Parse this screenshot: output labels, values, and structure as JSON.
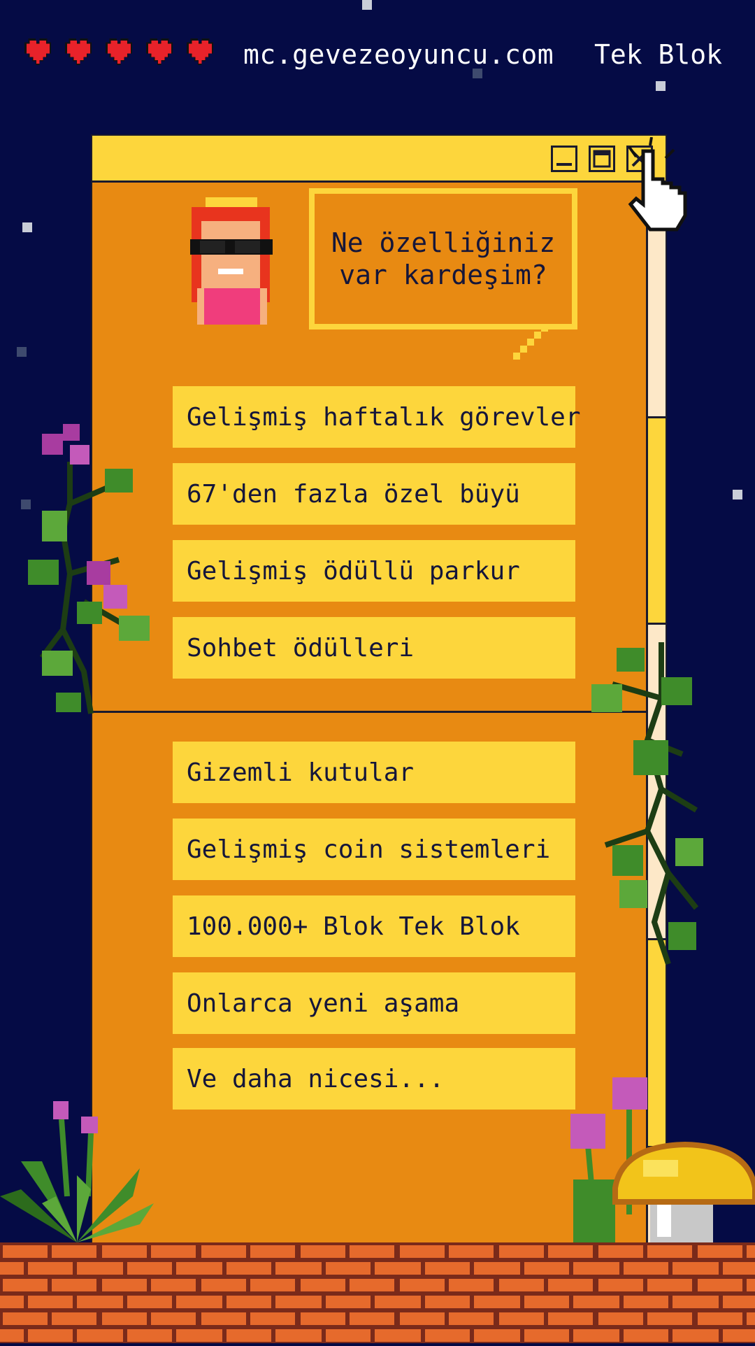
{
  "header": {
    "hearts": 5,
    "site_url": "mc.gevezeoyuncu.com",
    "brand": "Tek Blok"
  },
  "window": {
    "buttons": [
      "minimize-icon",
      "maximize-icon",
      "close-icon"
    ],
    "speech_bubble": "Ne özelliğiniz\nvar kardeşim?",
    "features_top": [
      "Gelişmiş haftalık görevler",
      "67'den fazla özel büyü",
      "Gelişmiş ödüllü parkur",
      "Sohbet ödülleri"
    ],
    "features_bottom": [
      "Gizemli kutular",
      "Gelişmiş coin sistemleri",
      "100.000+ Blok  Tek Blok",
      "Onlarca yeni aşama",
      "Ve daha nicesi..."
    ]
  },
  "colors": {
    "background": "#050b45",
    "window": "#e88a12",
    "accent": "#fdd63c",
    "heart": "#e8222a",
    "brick": "#e0632c"
  }
}
